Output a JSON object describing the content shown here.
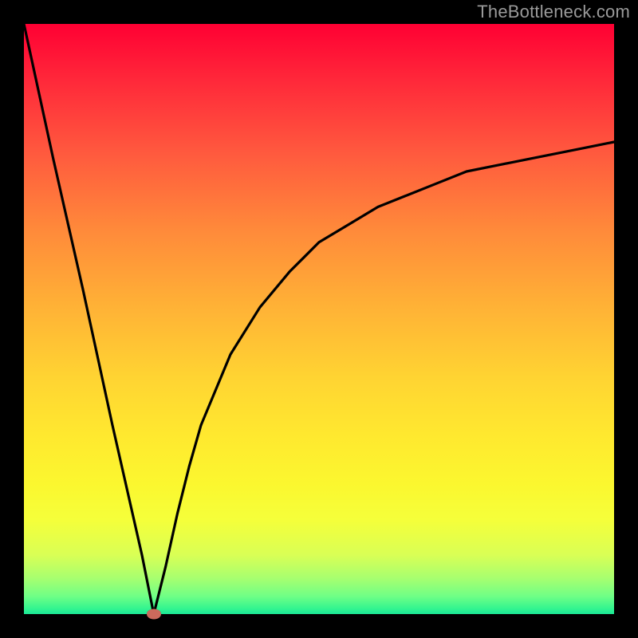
{
  "watermark": {
    "text": "TheBottleneck.com"
  },
  "chart_data": {
    "type": "line",
    "title": "",
    "xlabel": "",
    "ylabel": "",
    "xlim": [
      0,
      100
    ],
    "ylim": [
      0,
      100
    ],
    "grid": false,
    "legend": false,
    "background": "red-yellow-green vertical gradient",
    "curve_description": "bottleneck % vs. component scale; V-shape with minimum near x≈22, rising asymptotically toward ~80 at right",
    "x": [
      0,
      5,
      10,
      15,
      20,
      22,
      24,
      26,
      28,
      30,
      35,
      40,
      45,
      50,
      55,
      60,
      65,
      70,
      75,
      80,
      85,
      90,
      95,
      100
    ],
    "y": [
      100,
      77,
      55,
      32,
      10,
      0,
      8,
      17,
      25,
      32,
      44,
      52,
      58,
      63,
      66,
      69,
      71,
      73,
      75,
      76,
      77,
      78,
      79,
      80
    ],
    "optimum_marker": {
      "x": 22,
      "y": 0,
      "color": "#cc6a5c"
    }
  },
  "colors": {
    "curve": "#000000",
    "frame": "#000000",
    "marker": "#cc6a5c",
    "watermark": "#9a9a9a"
  }
}
